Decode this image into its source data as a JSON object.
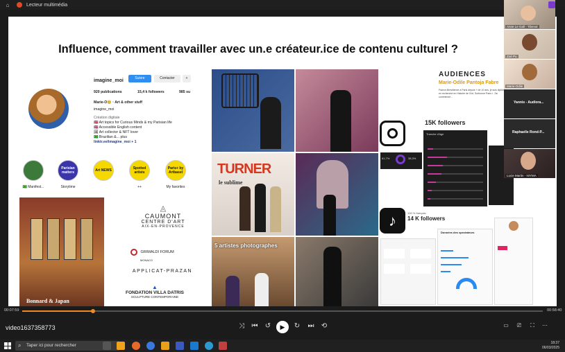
{
  "window": {
    "title": "Lecteur multimédia"
  },
  "slide": {
    "title": "Influence, comment travailler avec un.e créateur.ice de contenu culturel ?",
    "profile": {
      "username": "imagine_moi",
      "follow_label": "Suivre",
      "contact_label": "Contacter",
      "publications": "920 publications",
      "followers": "15,4 k followers",
      "following": "985 su",
      "name_line": "Marie-O😊 · Art & other stuff",
      "handle": "imagine_moi",
      "category": "Création digitale",
      "bio": [
        "🇬🇧 Art topics for Curious Minds & my Parisian life",
        "🇬🇧 Accessible English content",
        "🖼 Art collector & NFT lover",
        "🇧🇷 Brazilian &... plus"
      ],
      "link": "linktr.ee/imagine_moi + 1",
      "highlights": [
        {
          "label": "🇧🇷 Manifest...",
          "text": "",
          "color": "#3b7a3a"
        },
        {
          "label": "Storytime",
          "text": "Parisian matters",
          "color": "#3a36a8"
        },
        {
          "label": "",
          "text": "Art NEWS",
          "color": "#f5d800"
        },
        {
          "label": "++",
          "text": "Spotted artists",
          "color": "#f5d800"
        },
        {
          "label": "My favorites",
          "text": "Paris+ by Artbasel",
          "color": "#f5d800"
        }
      ]
    },
    "bonnard_caption": "Bonnard & Japan",
    "logos": {
      "caumont": [
        "CAUMONT",
        "CENTRE D'ART",
        "AIX-EN-PROVENCE"
      ],
      "grimaldi": [
        "GRIMALDI FORUM",
        "MONACO"
      ],
      "applicat": "APPLICAT-PRAZAN",
      "villa": [
        "FONDATION VILLA DATRIS",
        "SCULPTURE CONTEMPORAINE"
      ]
    },
    "turner_label": "TURNER",
    "turner_sub": "le sublime",
    "photographers_caption": "5 artistes photographes",
    "audiences": {
      "heading": "AUDIENCES",
      "subheading": "Marie-Odile Pantoja Fabre",
      "description": "France-Brésilienne à Paris depuis + de 10 ans, je suis diplômée en recherche en Histoire de l'Art, Sorbonne Paris I. J'ai commencé...",
      "instagram_followers": "15K followers",
      "tiktok_followers": "14 K followers",
      "tiktok_note": "100 % français"
    },
    "ig_stats": {
      "a": "61,7%",
      "b": "38,3%"
    },
    "age_table_title": "Tranche d'âge",
    "spectator_title": "Données des spectateurs"
  },
  "participants": [
    {
      "name": "Anne Le Gall - Tibenal"
    },
    {
      "name": "Zoé Pu"
    },
    {
      "name": "Marie-Odile"
    },
    {
      "name": "Yannis - Audiora..."
    },
    {
      "name": "Raphaelle Rond-P..."
    },
    {
      "name": "Lucie Martin - NIYMA"
    }
  ],
  "player": {
    "elapsed": "00:07:59",
    "total": "00:58:40",
    "progress": 0.136,
    "filename": "video1637358773"
  },
  "taskbar": {
    "search_placeholder": "Taper ici pour rechercher",
    "time": "18:37",
    "date": "06/03/2025"
  }
}
